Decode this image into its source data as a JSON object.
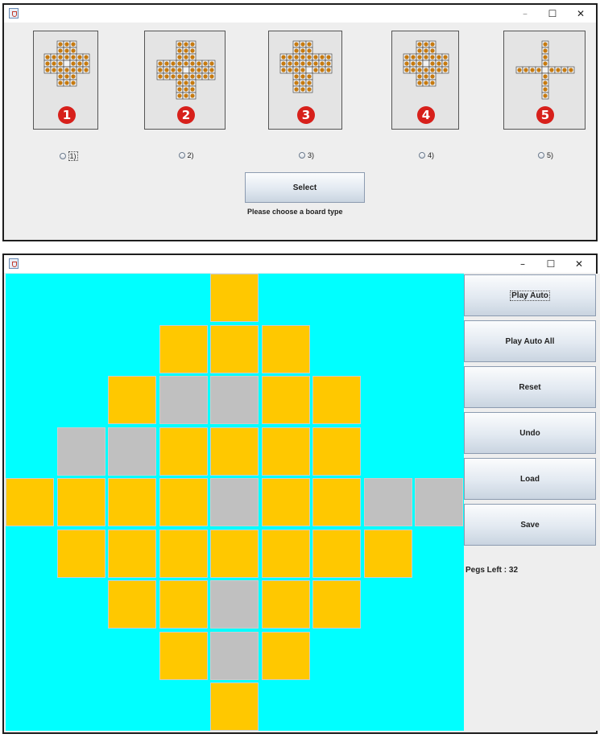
{
  "window_controls": {
    "minimize": "–",
    "maximize": "☐",
    "close": "✕"
  },
  "chooser": {
    "boards": [
      {
        "number": "1",
        "radio_label": "1)",
        "cross": [
          3,
          7
        ]
      },
      {
        "number": "2",
        "radio_label": "2)",
        "cross": [
          3,
          9
        ]
      },
      {
        "number": "3",
        "radio_label": "3)",
        "cross": [
          3,
          8
        ]
      },
      {
        "number": "4",
        "radio_label": "4)",
        "cross": [
          3,
          7
        ]
      },
      {
        "number": "5",
        "radio_label": "5)",
        "cross": [
          1,
          9
        ]
      }
    ],
    "select_label": "Select",
    "status": "Please choose a board type"
  },
  "game": {
    "board_rows": [
      "....P....",
      "...PPP...",
      "..PEEPP..",
      ".EEPPPP..",
      "PPPPEPPEE",
      ".PPPPPPP.",
      "..PPEPP..",
      "...PEP...",
      "....P...."
    ],
    "buttons": [
      "Play Auto",
      "Play Auto All",
      "Reset",
      "Undo",
      "Load",
      "Save"
    ],
    "pegs_left": "Pegs Left : 32"
  },
  "colors": {
    "board_bg": "#00ffff",
    "peg": "#ffc800",
    "empty": "#c0c0c0",
    "badge": "#d7201b"
  }
}
